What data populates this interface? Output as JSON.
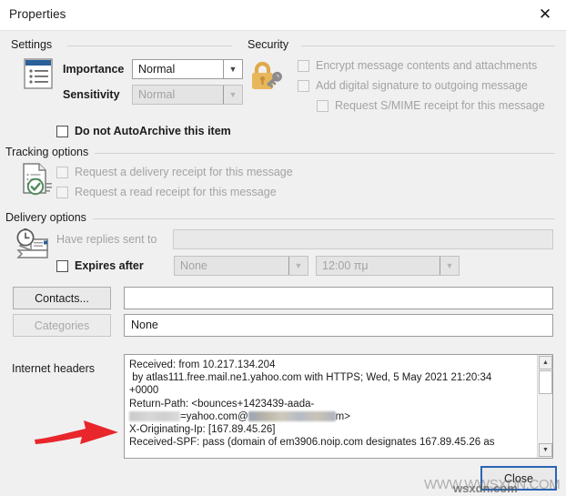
{
  "window": {
    "title": "Properties",
    "close_icon": "close-x-icon"
  },
  "settings": {
    "caption": "Settings",
    "icon": "properties-list-icon",
    "importance_label": "Importance",
    "importance_value": "Normal",
    "sensitivity_label": "Sensitivity",
    "sensitivity_value": "Normal",
    "autoarchive_label": "Do not AutoArchive this item",
    "autoarchive_checked": false
  },
  "security": {
    "caption": "Security",
    "icon": "padlock-key-icon",
    "encrypt_label": "Encrypt message contents and attachments",
    "signature_label": "Add digital signature to outgoing message",
    "smime_label": "Request S/MIME receipt for this message"
  },
  "tracking": {
    "caption": "Tracking options",
    "icon": "document-check-receipt-icon",
    "delivery_receipt_label": "Request a delivery receipt for this message",
    "read_receipt_label": "Request a read receipt for this message"
  },
  "delivery": {
    "caption": "Delivery options",
    "icon": "clock-envelope-icon",
    "replies_label": "Have replies sent to",
    "replies_value": "",
    "expires_label": "Expires after",
    "expires_checked": false,
    "expires_date": "None",
    "expires_time": "12:00 πμ",
    "contacts_button": "Contacts...",
    "contacts_value": "",
    "categories_button": "Categories",
    "categories_value": "None"
  },
  "headers": {
    "label": "Internet headers",
    "line1": "Received: from 10.217.134.204",
    "line2": " by atlas111.free.mail.ne1.yahoo.com with HTTPS; Wed, 5 May 2021 21:20:34",
    "line3": "+0000",
    "line4": "Return-Path: <bounces+1423439-aada-",
    "line5_after_redact1": "=yahoo.com@",
    "line5_after_redact2": "m>",
    "line6": "X-Originating-Ip: [167.89.45.26]",
    "line7": "Received-SPF: pass (domain of em3906.noip.com designates 167.89.45.26 as",
    "scroll_up_icon": "triangle-up-icon",
    "scroll_down_icon": "triangle-down-icon"
  },
  "footer": {
    "close_button": "Close"
  },
  "annotation": {
    "arrow": "red-arrow-pointing-right"
  },
  "watermark": {
    "big": "WWW.WWSXDN.COM",
    "small": "wsxdn.com"
  },
  "colors": {
    "dialog_bg": "#f0f0f0",
    "accent_blue": "#2a64b4",
    "lock_gold": "#e0a94a",
    "arrow_red": "#e8262b",
    "list_icon_blue": "#2a6099"
  }
}
